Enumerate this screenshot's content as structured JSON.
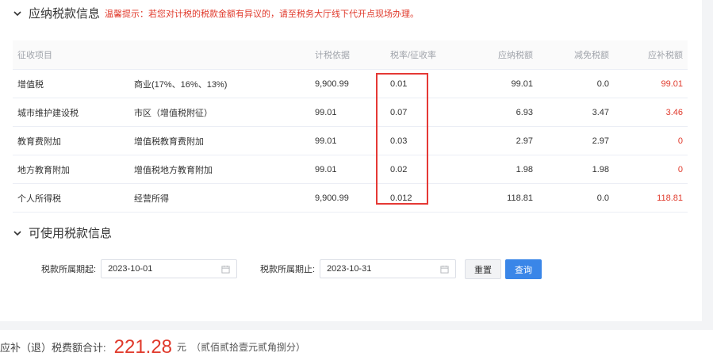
{
  "section1": {
    "title": "应纳税款信息",
    "tip": "温馨提示：若您对计税的税款金额有异议的，请至税务大厅线下代开点现场办理。"
  },
  "table": {
    "headers": [
      "征收项目",
      "",
      "计税依据",
      "税率/征收率",
      "应纳税额",
      "减免税额",
      "应补税额"
    ],
    "rows": [
      [
        "增值税",
        "商业(17%、16%、13%)",
        "9,900.99",
        "0.01",
        "99.01",
        "0.0",
        "99.01"
      ],
      [
        "城市维护建设税",
        "市区（增值税附征）",
        "99.01",
        "0.07",
        "6.93",
        "3.47",
        "3.46"
      ],
      [
        "教育费附加",
        "增值税教育费附加",
        "99.01",
        "0.03",
        "2.97",
        "2.97",
        "0"
      ],
      [
        "地方教育附加",
        "增值税地方教育附加",
        "99.01",
        "0.02",
        "1.98",
        "1.98",
        "0"
      ],
      [
        "个人所得税",
        "经营所得",
        "9,900.99",
        "0.012",
        "118.81",
        "0.0",
        "118.81"
      ]
    ]
  },
  "section2": {
    "title": "可使用税款信息",
    "start_label": "税款所属期起:",
    "start_value": "2023-10-01",
    "end_label": "税款所属期止:",
    "end_value": "2023-10-31",
    "reset_label": "重置",
    "query_label": "查询"
  },
  "footer": {
    "label": "应补（退）税费额合计:",
    "amount": "221.28",
    "unit": "元",
    "words": "（贰佰贰拾壹元贰角捌分）"
  },
  "colors": {
    "accent": "#3a86e8",
    "warning": "#e0392b",
    "highlight_box": "#e53935"
  }
}
